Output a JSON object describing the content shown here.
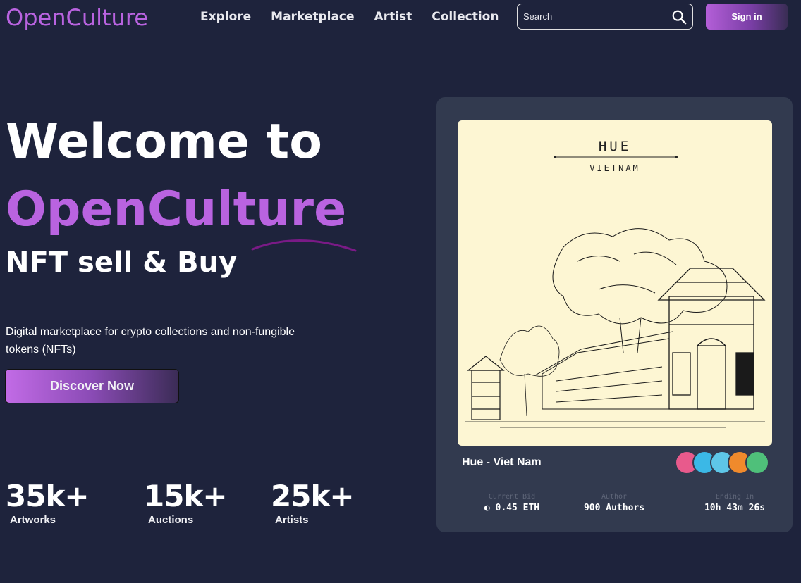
{
  "header": {
    "logo": "OpenCulture",
    "nav": [
      "Explore",
      "Marketplace",
      "Artist",
      "Collection"
    ],
    "search_placeholder": "Search",
    "signin_label": "Sign in"
  },
  "hero": {
    "line1": "Welcome to",
    "line2": "OpenCulture",
    "line3": "NFT sell & Buy",
    "description": "Digital marketplace for crypto collections and non-fungible tokens (NFTs)",
    "cta_label": "Discover Now"
  },
  "stats": [
    {
      "value": "35k+",
      "label": "Artworks"
    },
    {
      "value": "15k+",
      "label": "Auctions"
    },
    {
      "value": "25k+",
      "label": "Artists"
    }
  ],
  "card": {
    "art_heading": "HUE",
    "art_subheading": "VIETNAM",
    "title": "Hue - Viet Nam",
    "bid_key": "Current Bid",
    "bid_value": "0.45 ETH",
    "author_key": "Author",
    "author_value": "900 Authors",
    "ending_key": "Ending In",
    "ending_value": "10h 43m 26s",
    "avatar_colors": [
      "#e85a8c",
      "#3bb8e6",
      "#5ec6e8",
      "#f08a2c",
      "#4fc07a"
    ]
  }
}
